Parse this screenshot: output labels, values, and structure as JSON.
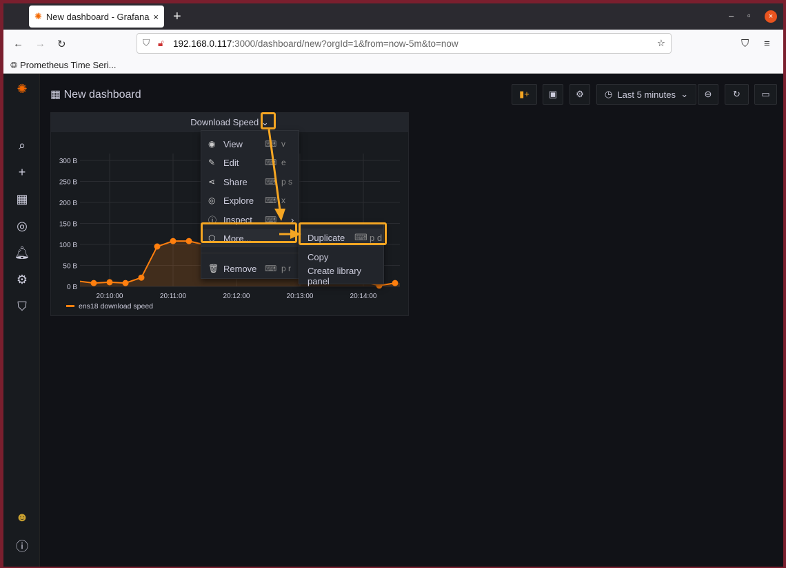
{
  "browser": {
    "tab_title": "New dashboard - Grafana",
    "url_host": "192.168.0.117",
    "url_rest": ":3000/dashboard/new?orgId=1&from=now-5m&to=now",
    "bookmark": "Prometheus Time Seri..."
  },
  "dashboard": {
    "title": "New dashboard",
    "time_range": "Last 5 minutes"
  },
  "panel": {
    "title": "Download Speed",
    "legend": "ens18 download speed"
  },
  "menu": [
    {
      "icon": "eye-icon",
      "label": "View",
      "shortcut": "v"
    },
    {
      "icon": "edit-icon",
      "label": "Edit",
      "shortcut": "e"
    },
    {
      "icon": "share-icon",
      "label": "Share",
      "shortcut": "p s"
    },
    {
      "icon": "compass-icon",
      "label": "Explore",
      "shortcut": "x"
    },
    {
      "icon": "info-icon",
      "label": "Inspect",
      "shortcut": ""
    },
    {
      "icon": "cube-icon",
      "label": "More...",
      "shortcut": ""
    },
    {
      "icon": "trash-icon",
      "label": "Remove",
      "shortcut": "p r"
    }
  ],
  "submenu": [
    {
      "label": "Duplicate",
      "shortcut": "p d"
    },
    {
      "label": "Copy"
    },
    {
      "label": "Create library panel"
    }
  ],
  "colors": {
    "accent": "#ff7f0e",
    "highlight": "#f5a623"
  },
  "chart_data": {
    "type": "area",
    "series": [
      {
        "name": "ens18 download speed",
        "x": [
          "20:09:45",
          "20:10:00",
          "20:10:15",
          "20:10:30",
          "20:10:45",
          "20:11:00",
          "20:11:15",
          "20:14:15",
          "20:14:30"
        ],
        "y": [
          8,
          10,
          8,
          21,
          95,
          108,
          108,
          2,
          8
        ]
      }
    ],
    "yticks": [
      "0 B",
      "50 B",
      "100 B",
      "150 B",
      "200 B",
      "250 B",
      "300 B"
    ],
    "xticks": [
      "20:10:00",
      "20:11:00",
      "20:12:00",
      "20:13:00",
      "20:14:00"
    ],
    "ylim": [
      0,
      300
    ],
    "grid": true,
    "legend": "bottom-left"
  }
}
